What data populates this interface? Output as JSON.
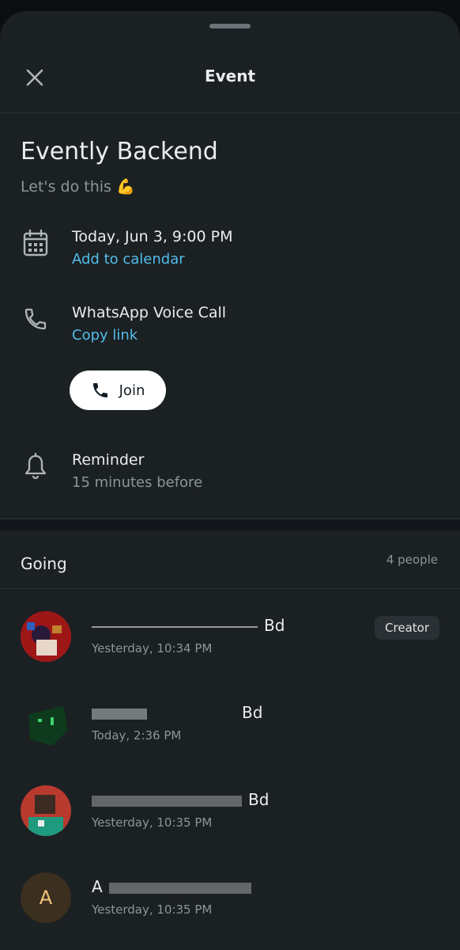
{
  "header": {
    "title": "Event",
    "close_icon": "close-icon"
  },
  "event": {
    "title": "Evently Backend",
    "subtitle": "Let's do this 💪"
  },
  "datetime": {
    "icon": "calendar-icon",
    "primary": "Today, Jun 3, 9:00 PM",
    "action": "Add to calendar"
  },
  "call": {
    "icon": "phone-icon",
    "primary": "WhatsApp Voice Call",
    "action": "Copy link",
    "join_label": "Join"
  },
  "reminder": {
    "icon": "bell-icon",
    "primary": "Reminder",
    "secondary": "15 minutes before"
  },
  "going": {
    "label": "Going",
    "count": "4 people",
    "people": [
      {
        "name": "Bd",
        "time": "Yesterday, 10:34 PM",
        "badge": "Creator"
      },
      {
        "name": "Bd",
        "time": "Today, 2:36 PM"
      },
      {
        "name": "Bd",
        "time": "Yesterday, 10:35 PM"
      },
      {
        "name": "A",
        "initial": "A",
        "time": "Yesterday, 10:35 PM"
      }
    ]
  },
  "colors": {
    "background": "#1b2023",
    "accent_link": "#53bdeb",
    "text_primary": "#e9edef",
    "text_secondary": "#8d959a"
  }
}
